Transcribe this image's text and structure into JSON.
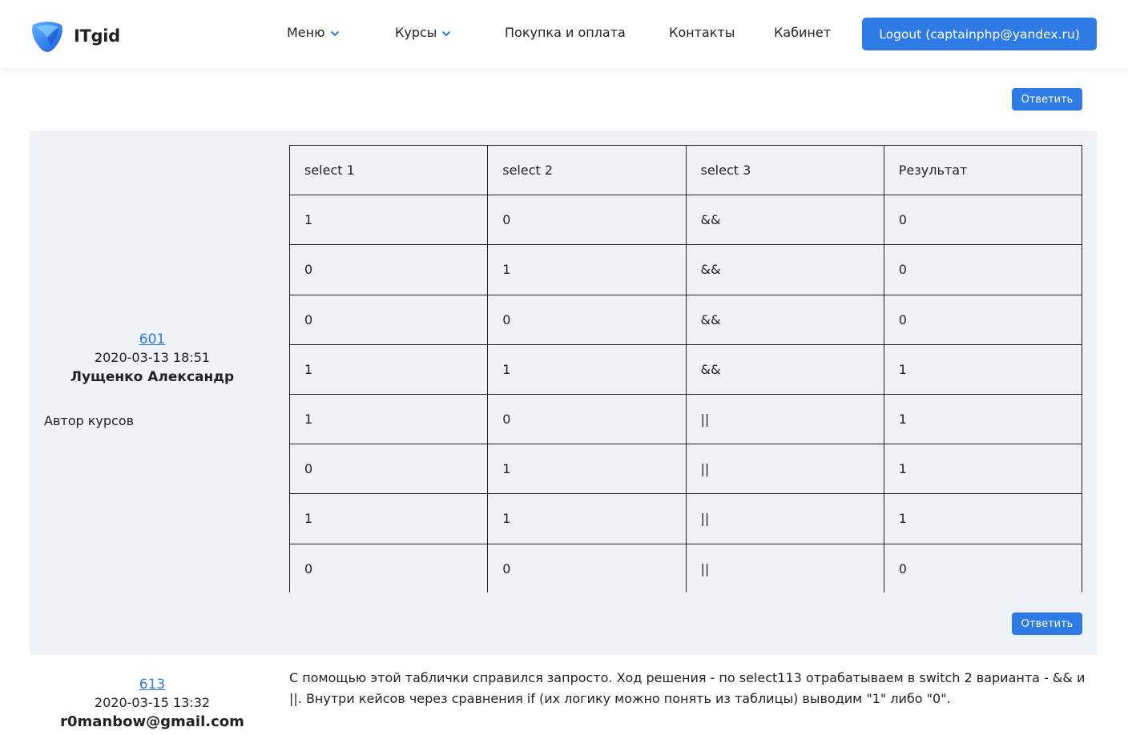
{
  "header": {
    "brand": "ITgid",
    "nav": [
      {
        "label": "Меню",
        "has_dropdown": true
      },
      {
        "label": "Курсы",
        "has_dropdown": true
      },
      {
        "label": "Покупка и оплата",
        "has_dropdown": false
      },
      {
        "label": "Контакты",
        "has_dropdown": false
      },
      {
        "label": "Кабинет",
        "has_dropdown": false
      }
    ],
    "logout_label": "Logout (captainphp@yandex.ru)"
  },
  "reply_label": "Ответить",
  "comments": [
    {
      "id": "601",
      "date": "2020-03-13 18:51",
      "author": "Лущенко Александр",
      "role": "Автор курсов",
      "table": {
        "headers": [
          "select 1",
          "select 2",
          "select 3",
          "Результат"
        ],
        "rows": [
          [
            "1",
            "0",
            "&&",
            "0"
          ],
          [
            "0",
            "1",
            "&&",
            "0"
          ],
          [
            "0",
            "0",
            "&&",
            "0"
          ],
          [
            "1",
            "1",
            "&&",
            "1"
          ],
          [
            "1",
            "0",
            "||",
            "1"
          ],
          [
            "0",
            "1",
            "||",
            "1"
          ],
          [
            "1",
            "1",
            "||",
            "1"
          ],
          [
            "0",
            "0",
            "||",
            "0"
          ]
        ]
      }
    },
    {
      "id": "613",
      "date": "2020-03-15 13:32",
      "author": "r0manbow@gmail.com",
      "text": "С помощью этой таблички справился запросто. Ход решения - по select113 отрабатываем в switch 2 варианта - && и ||. Внутри кейсов через сравнения if (их логику можно понять из таблицы) выводим \"1\" либо \"0\"."
    }
  ],
  "colors": {
    "accent": "#2f7be5",
    "comment_bg": "#eff2f7",
    "text": "#222222"
  },
  "icons": {
    "logo": "itgid-logo-icon",
    "dropdown": "chevron-down-icon"
  }
}
